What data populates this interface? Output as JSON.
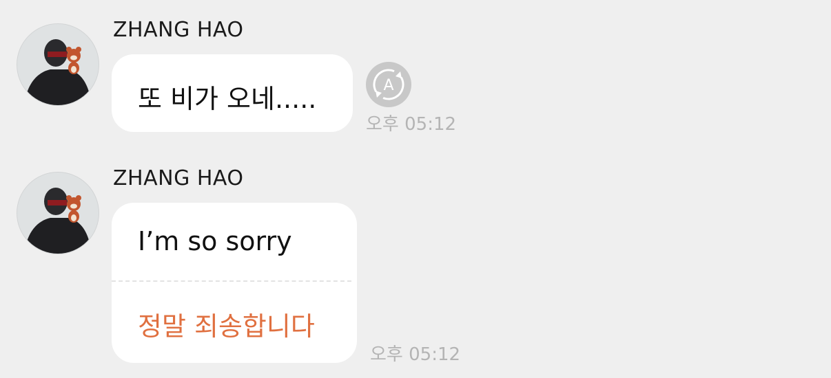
{
  "messages": [
    {
      "sender": "ZHANG HAO",
      "text": "또 비가 오네.....",
      "time": "오후 05:12",
      "has_translate_button": true,
      "translate_icon": "translate-a-icon"
    },
    {
      "sender": "ZHANG HAO",
      "text": "I’m so sorry",
      "translation": "정말 죄송합니다",
      "time": "오후 05:12"
    }
  ],
  "colors": {
    "background": "#efefef",
    "bubble": "#ffffff",
    "translation_text": "#e07040",
    "timestamp": "#b4b4b4"
  }
}
